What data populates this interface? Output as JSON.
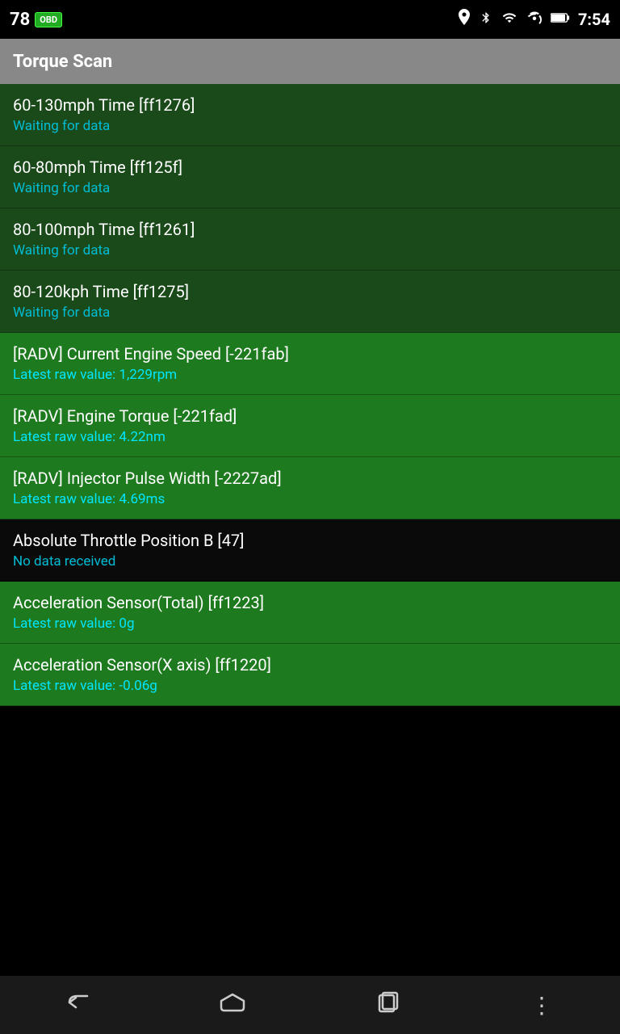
{
  "statusBar": {
    "number": "78",
    "obdLabel": "OBD",
    "time": "7:54"
  },
  "appBar": {
    "title": "Torque Scan"
  },
  "listItems": [
    {
      "id": "item-1",
      "title": "60-130mph Time [ff1276]",
      "subtitle": "Waiting for data",
      "subtitleClass": "waiting",
      "bgClass": "dark-green"
    },
    {
      "id": "item-2",
      "title": "60-80mph Time [ff125f]",
      "subtitle": "Waiting for data",
      "subtitleClass": "waiting",
      "bgClass": "dark-green"
    },
    {
      "id": "item-3",
      "title": "80-100mph Time [ff1261]",
      "subtitle": "Waiting for data",
      "subtitleClass": "waiting",
      "bgClass": "dark-green"
    },
    {
      "id": "item-4",
      "title": "80-120kph Time [ff1275]",
      "subtitle": "Waiting for data",
      "subtitleClass": "waiting",
      "bgClass": "dark-green"
    },
    {
      "id": "item-5",
      "title": "[RADV] Current Engine Speed [-221fab]",
      "subtitle": "Latest raw value: 1,229rpm",
      "subtitleClass": "raw-value",
      "bgClass": "bright-green"
    },
    {
      "id": "item-6",
      "title": "[RADV] Engine Torque [-221fad]",
      "subtitle": "Latest raw value: 4.22nm",
      "subtitleClass": "raw-value",
      "bgClass": "bright-green"
    },
    {
      "id": "item-7",
      "title": "[RADV] Injector Pulse Width [-2227ad]",
      "subtitle": "Latest raw value: 4.69ms",
      "subtitleClass": "raw-value",
      "bgClass": "bright-green"
    },
    {
      "id": "item-8",
      "title": "Absolute Throttle Position B [47]",
      "subtitle": "No data received",
      "subtitleClass": "no-data",
      "bgClass": "black-bg"
    },
    {
      "id": "item-9",
      "title": "Acceleration Sensor(Total) [ff1223]",
      "subtitle": "Latest raw value: 0g",
      "subtitleClass": "raw-value",
      "bgClass": "bright-green"
    },
    {
      "id": "item-10",
      "title": "Acceleration Sensor(X axis) [ff1220]",
      "subtitle": "Latest raw value: -0.06g",
      "subtitleClass": "raw-value",
      "bgClass": "bright-green"
    }
  ],
  "navBar": {
    "backLabel": "back",
    "homeLabel": "home",
    "recentsLabel": "recents",
    "moreLabel": "more"
  }
}
